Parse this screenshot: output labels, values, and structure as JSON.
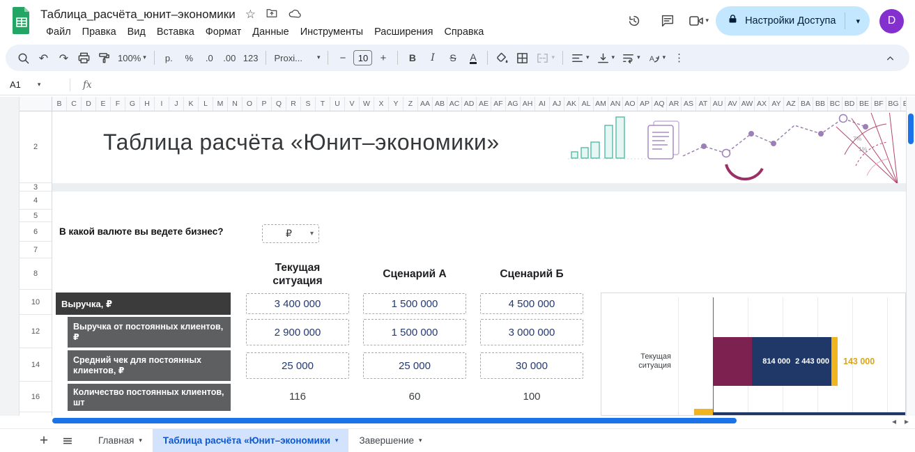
{
  "icons": {
    "undo": "↶",
    "redo": "↷",
    "star": "☆",
    "more_vertical": "⋮",
    "hamburger": "≡",
    "caret": "▾",
    "scroll_left": "◂",
    "scroll_right": "▸",
    "plus": "+",
    "minus": "−"
  },
  "titlebar": {
    "doc_title": "Таблица_расчёта_юнит–экономики",
    "menu_items": [
      "Файл",
      "Правка",
      "Вид",
      "Вставка",
      "Формат",
      "Данные",
      "Инструменты",
      "Расширения",
      "Справка"
    ],
    "share_button_label": "Настройки Доступа",
    "avatar_letter": "D"
  },
  "toolbar": {
    "zoom_value": "100%",
    "currency_format": "р.",
    "percent_format": "%",
    "decrease_decimals": ".0",
    "increase_decimals": ".00",
    "number_format": "123",
    "font_name": "Proxi...",
    "font_size": "10",
    "bold_label": "B",
    "italic_label": "I",
    "strikethrough_label": "S",
    "text_color_label": "A"
  },
  "formula_bar": {
    "cell_reference": "A1",
    "fx_label": "fx"
  },
  "grid": {
    "column_letters": [
      "B",
      "C",
      "D",
      "E",
      "F",
      "G",
      "H",
      "I",
      "J",
      "K",
      "L",
      "M",
      "N",
      "O",
      "P",
      "Q",
      "R",
      "S",
      "T",
      "U",
      "V",
      "W",
      "X",
      "Y",
      "Z",
      "AA",
      "AB",
      "AC",
      "AD",
      "AE",
      "AF",
      "AG",
      "AH",
      "AI",
      "AJ",
      "AK",
      "AL",
      "AM",
      "AN",
      "AO",
      "AP",
      "AQ",
      "AR",
      "AS",
      "AT",
      "AU",
      "AV",
      "AW",
      "AX",
      "AY",
      "AZ",
      "BA",
      "BB",
      "BC",
      "BD",
      "BE",
      "BF",
      "BG",
      "BH"
    ],
    "row_numbers": [
      "2",
      "3",
      "4",
      "5",
      "6",
      "7",
      "8",
      "10",
      "12",
      "14",
      "16"
    ],
    "sheet_title": "Таблица расчёта «Юнит–экономики»",
    "currency_question": "В какой валюте вы ведете бизнес?",
    "currency_selected": "₽",
    "scenario_headers": [
      "Текущая\nситуация",
      "Сценарий А",
      "Сценарий Б"
    ],
    "data_rows": [
      {
        "label": "Выручка, ₽",
        "values": [
          "3 400 000",
          "1 500 000",
          "4 500 000"
        ]
      },
      {
        "label": "Выручка от постоянных клиентов, ₽",
        "values": [
          "2 900 000",
          "1 500 000",
          "3 000 000"
        ]
      },
      {
        "label": "Средний чек для постоянных клиентов, ₽",
        "values": [
          "25 000",
          "25 000",
          "30 000"
        ]
      },
      {
        "label": "Количество постоянных клиентов, шт",
        "values": [
          "116",
          "60",
          "100"
        ]
      }
    ]
  },
  "chart": {
    "type": "bar",
    "category": "Текущая\nситуация",
    "bar_labels": [
      "814 000",
      "2 443 000"
    ],
    "end_label": "143 000",
    "colors": {
      "maroon": "#7c2150",
      "navy": "#1f3868",
      "gold": "#f0b41e"
    }
  },
  "decor": {
    "percent_label_1": "7%",
    "percent_label_2": "1%"
  },
  "sheet_tabs": {
    "tabs": [
      {
        "label": "Главная",
        "active": false
      },
      {
        "label": "Таблица расчёта «Юнит–экономики",
        "active": true
      },
      {
        "label": "Завершение",
        "active": false
      }
    ]
  }
}
